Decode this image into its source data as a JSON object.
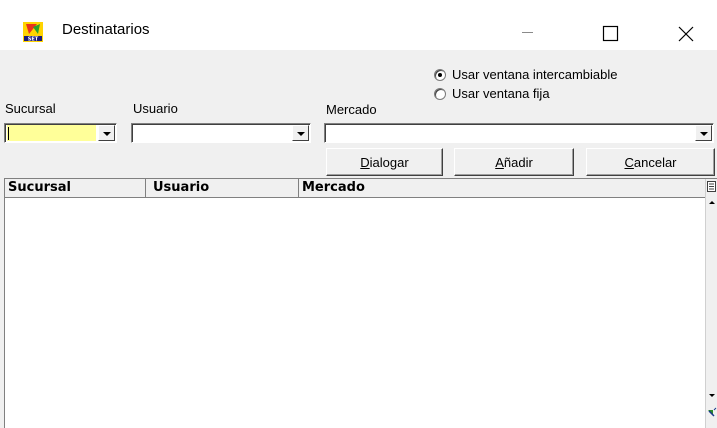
{
  "window": {
    "title": "Destinatarios",
    "icon": "set-app-icon",
    "controls": [
      "minimize",
      "maximize",
      "close"
    ]
  },
  "options": {
    "radio_interchangeable": {
      "label": "Usar ventana intercambiable",
      "checked": true
    },
    "radio_fixed": {
      "label": "Usar ventana fija",
      "checked": false
    }
  },
  "filters": {
    "sucursal_label": "Sucursal",
    "usuario_label": "Usuario",
    "mercado_label": "Mercado",
    "sucursal_value": "",
    "usuario_value": "",
    "mercado_value": ""
  },
  "buttons": {
    "dialogar": {
      "mnemonic": "D",
      "rest": "ialogar"
    },
    "anadir": {
      "mnemonic": "A",
      "rest": "ñadir"
    },
    "cancelar": {
      "mnemonic": "C",
      "rest": "ancelar"
    }
  },
  "grid": {
    "columns": [
      "Sucursal",
      "Usuario",
      "Mercado"
    ],
    "rows": []
  },
  "colors": {
    "window_bg": "#f0f0f0",
    "focus_field_bg": "#ffff99",
    "titlebar_bg": "#ffffff"
  }
}
